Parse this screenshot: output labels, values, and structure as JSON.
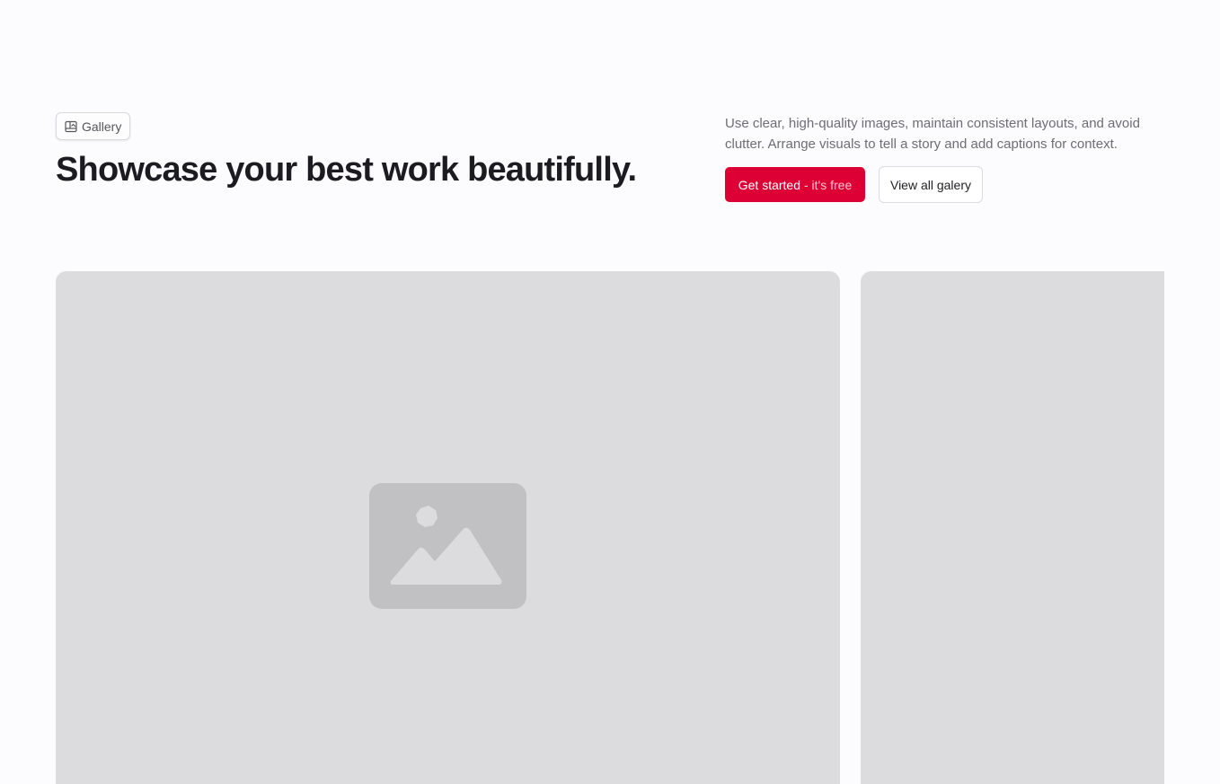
{
  "badge": {
    "label": "Gallery",
    "icon": "gallery-icon"
  },
  "headline": "Showcase your best work beautifully.",
  "description": "Use clear, high-quality images, maintain consistent layouts, and avoid clutter. Arrange visuals to tell a story and add captions for context.",
  "buttons": {
    "primary_label": "Get started",
    "primary_suffix": "- it's free",
    "secondary_label": "View all galery"
  },
  "gallery": {
    "items": [
      {
        "icon": "image-placeholder-icon"
      },
      {
        "icon": "image-placeholder-icon"
      }
    ]
  },
  "colors": {
    "accent": "#dc0035",
    "background": "#fcfbfe",
    "card": "#dcdbde",
    "placeholder_icon": "#c1c0c3",
    "heading": "#1c1c20",
    "muted_text": "#6d6d75"
  }
}
